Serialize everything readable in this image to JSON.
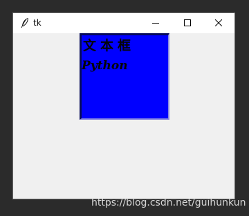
{
  "window": {
    "title": "tk"
  },
  "canvas": {
    "background_color": "#0000ff",
    "line1": "文本框",
    "line2": "Python"
  },
  "watermark": {
    "text": "https://blog.csdn.net/guihunkun"
  },
  "icons": {
    "app": "feather-icon",
    "minimize": "minimize-icon",
    "maximize": "maximize-icon",
    "close": "close-icon"
  }
}
